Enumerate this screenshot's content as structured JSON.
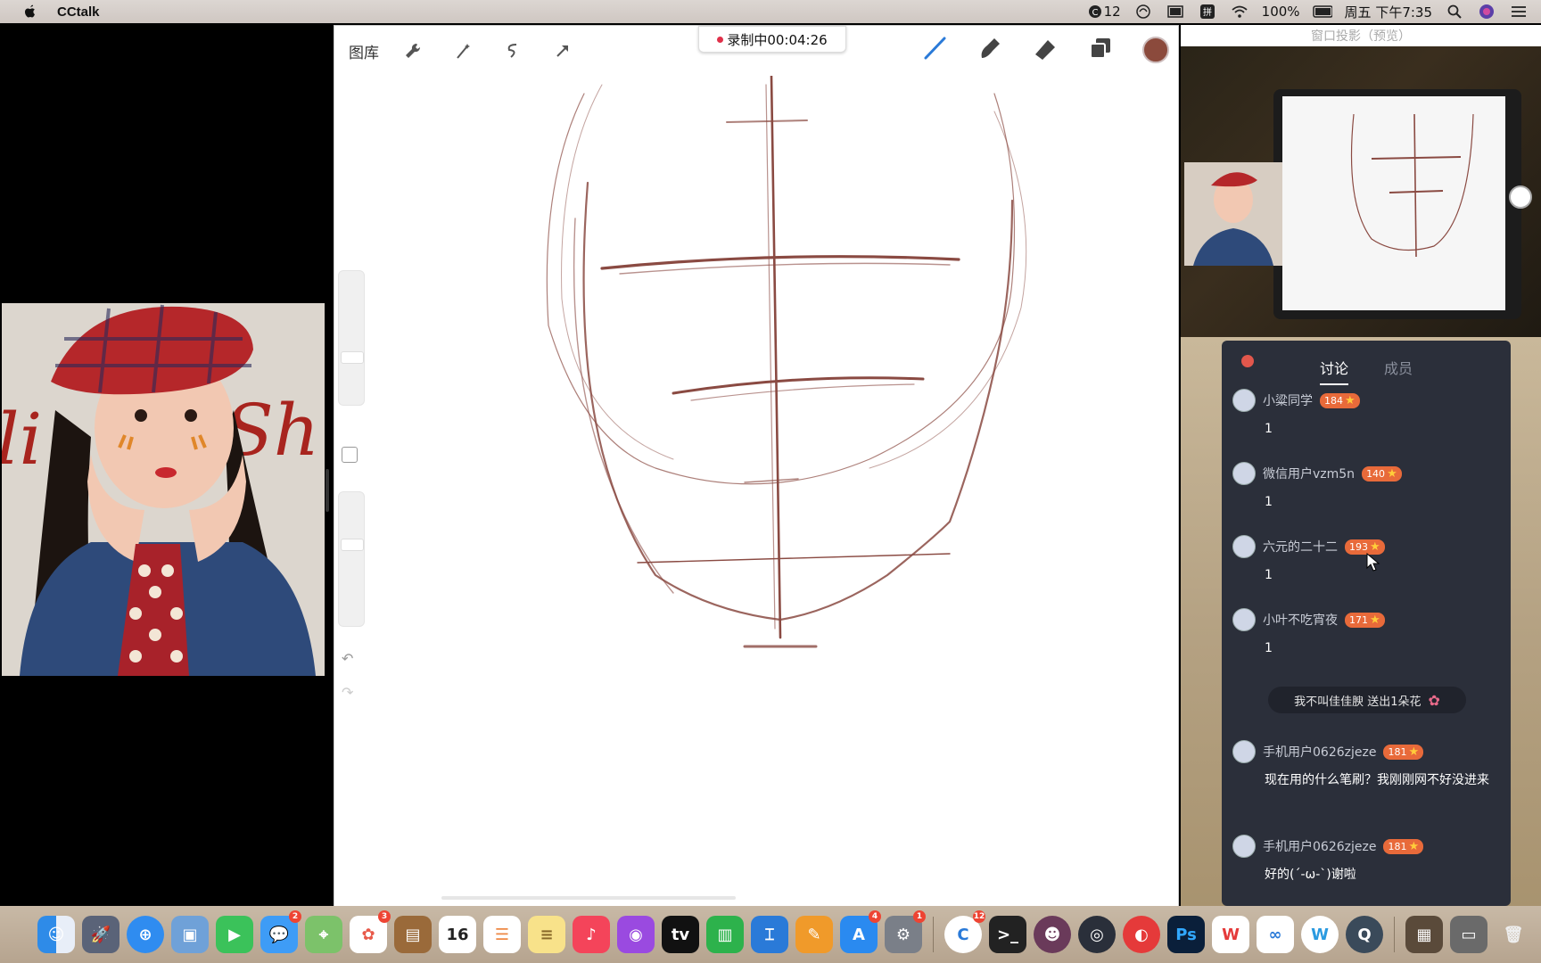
{
  "menubar": {
    "app_name": "CCtalk",
    "status_12": "12",
    "battery": "100%",
    "datetime": "周五 下午7:35"
  },
  "procreate": {
    "gallery_label": "图库",
    "recording_label": "录制中00:04:26",
    "brush_color": "#8b4a3c"
  },
  "preview": {
    "title": "窗口投影（预览）"
  },
  "chat": {
    "tabs": [
      "讨论",
      "成员"
    ],
    "messages": [
      {
        "user": "小粱同学",
        "level": "184",
        "text": "1"
      },
      {
        "user": "微信用户vzm5n",
        "level": "140",
        "text": "1"
      },
      {
        "user": "六元的二十二",
        "level": "193",
        "text": "1"
      },
      {
        "user": "小叶不吃宵夜",
        "level": "171",
        "text": "1"
      },
      {
        "user": "手机用户0626zjeze",
        "level": "181",
        "text": "现在用的什么笔刷？我刚刚网不好没进来"
      },
      {
        "user": "手机用户0626zjeze",
        "level": "181",
        "text": "好的(´-ω-`)谢啦"
      }
    ],
    "gift_text": "我不叫佳佳腴 送出1朵花"
  },
  "dock": {
    "calendar_day": "16",
    "badges": {
      "messages": "2",
      "photos": "3",
      "appstore": "4",
      "settings": "1",
      "cctalk": "12"
    }
  }
}
